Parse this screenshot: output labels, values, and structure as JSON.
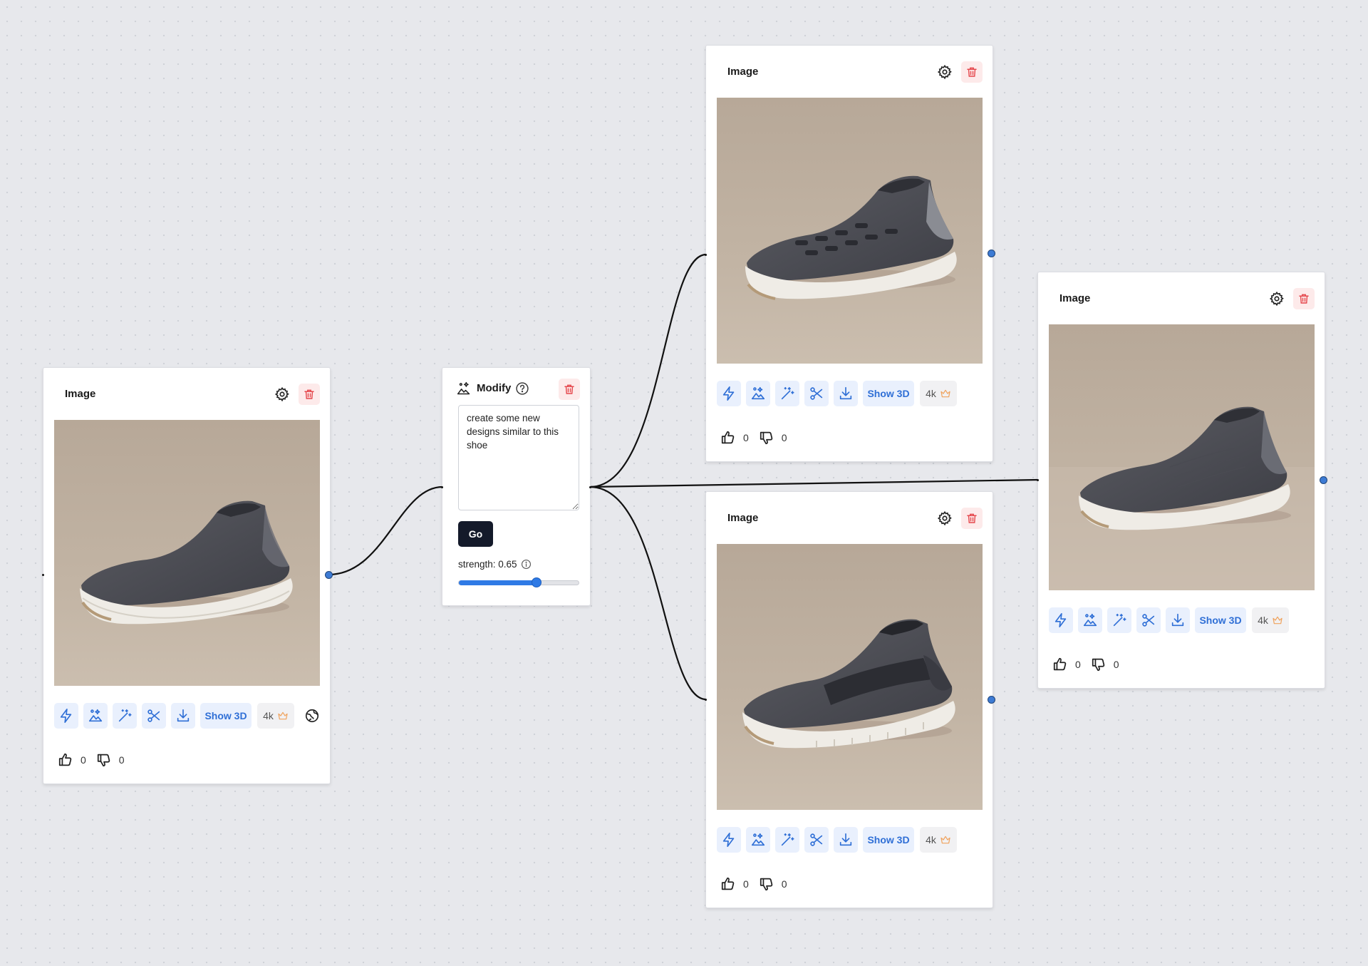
{
  "nodes": {
    "source": {
      "title": "Image",
      "show3d_label": "Show 3D",
      "upscale_label": "4k",
      "likes": "0",
      "dislikes": "0"
    },
    "modify": {
      "title": "Modify",
      "prompt": "create some new designs similar to this shoe",
      "go_label": "Go",
      "strength_label": "strength: 0.65",
      "strength": 0.65
    },
    "result1": {
      "title": "Image",
      "show3d_label": "Show 3D",
      "upscale_label": "4k",
      "likes": "0",
      "dislikes": "0"
    },
    "result2": {
      "title": "Image",
      "show3d_label": "Show 3D",
      "upscale_label": "4k",
      "likes": "0",
      "dislikes": "0"
    },
    "result3": {
      "title": "Image",
      "show3d_label": "Show 3D",
      "upscale_label": "4k",
      "likes": "0",
      "dislikes": "0"
    }
  },
  "colors": {
    "canvas_bg": "#e7e8ec",
    "accent_blue": "#2f7ae5",
    "icon_blue": "#2f6fd6",
    "danger_red": "#e5484d",
    "crown_orange": "#f0a35e",
    "go_button": "#141a2a",
    "shoe_backdrop": "#b9aa9a"
  },
  "icons": {
    "toolbar": [
      "lightning-icon",
      "image-edit-icon",
      "magic-wand-icon",
      "scissors-icon",
      "download-icon"
    ],
    "header": [
      "gear-icon",
      "trash-icon"
    ],
    "misc": [
      "crown-icon",
      "globe-icon",
      "thumbs-up-icon",
      "thumbs-down-icon",
      "help-circle-icon",
      "info-icon"
    ]
  }
}
